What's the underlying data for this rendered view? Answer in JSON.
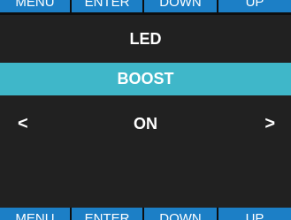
{
  "top_buttons": [
    "MENU",
    "ENTER",
    "DOWN",
    "UP"
  ],
  "menu": {
    "title": "LED",
    "selected_item": "BOOST",
    "value": "ON",
    "left_arrow": "<",
    "right_arrow": ">"
  },
  "softkeys": [
    "MENU",
    "ENTER",
    "DOWN",
    "UP"
  ],
  "colors": {
    "button_blue": "#1c7fc6",
    "highlight_teal": "#3fb7c9",
    "screen_background": "#212121",
    "divider": "#0e0e0e",
    "text": "#ffffff"
  }
}
